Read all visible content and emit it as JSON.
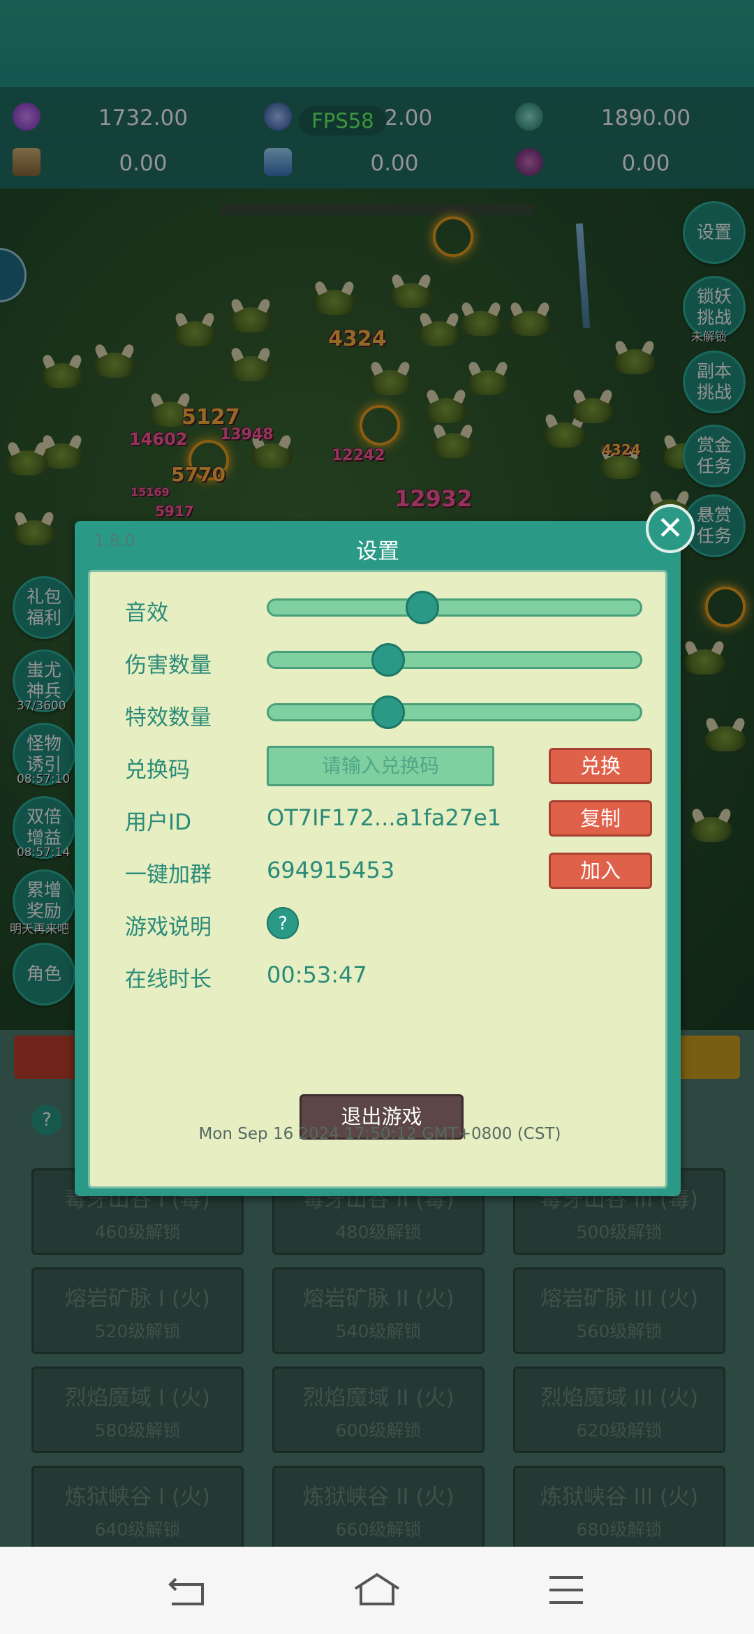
{
  "resources": [
    {
      "icon": "purple-gem-icon",
      "value": "1732.00"
    },
    {
      "icon": "blue-orb-icon",
      "value": "432.00"
    },
    {
      "icon": "teal-orb-icon",
      "value": "1890.00"
    },
    {
      "icon": "scroll-icon",
      "value": "0.00"
    },
    {
      "icon": "blue-crystal-icon",
      "value": "0.00"
    },
    {
      "icon": "purple-potion-icon",
      "value": "0.00"
    }
  ],
  "fps": "FPS58",
  "damage_numbers": [
    "4324",
    "5127",
    "14602",
    "13948",
    "5770",
    "12242",
    "12932",
    "15169",
    "5917",
    "4324"
  ],
  "right_menu": [
    {
      "label": "设置"
    },
    {
      "label": "锁妖挑战",
      "tag": "未解锁"
    },
    {
      "label": "副本挑战"
    },
    {
      "label": "赏金任务"
    },
    {
      "label": "悬赏任务"
    }
  ],
  "left_menu": [
    {
      "label": "礼包福利"
    },
    {
      "label": "蚩尤神兵",
      "tag": "37/3600"
    },
    {
      "label": "怪物诱引",
      "tag": "08:57:10"
    },
    {
      "label": "双倍增益",
      "tag": "08:57:14"
    },
    {
      "label": "累增奖励",
      "tag": "明天再来吧"
    },
    {
      "label": "角色"
    }
  ],
  "locked_cells": [
    {
      "name": "毒牙山谷 I (毒)",
      "lock": "460级解锁"
    },
    {
      "name": "毒牙山谷 II (毒)",
      "lock": "480级解锁"
    },
    {
      "name": "毒牙山谷 III (毒)",
      "lock": "500级解锁"
    },
    {
      "name": "熔岩矿脉 I (火)",
      "lock": "520级解锁"
    },
    {
      "name": "熔岩矿脉 II (火)",
      "lock": "540级解锁"
    },
    {
      "name": "熔岩矿脉 III (火)",
      "lock": "560级解锁"
    },
    {
      "name": "烈焰魔域 I (火)",
      "lock": "580级解锁"
    },
    {
      "name": "烈焰魔域 II (火)",
      "lock": "600级解锁"
    },
    {
      "name": "烈焰魔域 III (火)",
      "lock": "620级解锁"
    },
    {
      "name": "炼狱峡谷 I (火)",
      "lock": "640级解锁"
    },
    {
      "name": "炼狱峡谷 II (火)",
      "lock": "660级解锁"
    },
    {
      "name": "炼狱峡谷 III (火)",
      "lock": "680级解锁"
    }
  ],
  "dialog": {
    "version": "1.8.0",
    "title": "设置",
    "sound_label": "音效",
    "sound_level": 0.4,
    "damage_count_label": "伤害数量",
    "damage_count_level": 0.3,
    "effects_count_label": "特效数量",
    "effects_count_level": 0.3,
    "redeem_label": "兑换码",
    "redeem_placeholder": "请输入兑换码",
    "redeem_button": "兑换",
    "user_id_label": "用户ID",
    "user_id_value": "OT7IF172...a1fa27e1",
    "copy_button": "复制",
    "group_label": "一键加群",
    "group_value": "694915453",
    "join_button": "加入",
    "help_label": "游戏说明",
    "help_icon": "?",
    "online_label": "在线时长",
    "online_value": "00:53:47",
    "exit_button": "退出游戏",
    "timestamp": "Mon Sep 16 2024 17:50:12 GMT+0800 (CST)"
  },
  "colors": {
    "accent": "#2a9a86",
    "panel": "#e6eec2",
    "red_button": "#e0614a",
    "exit_button": "#5c4646",
    "label_text": "#2a8b78"
  }
}
